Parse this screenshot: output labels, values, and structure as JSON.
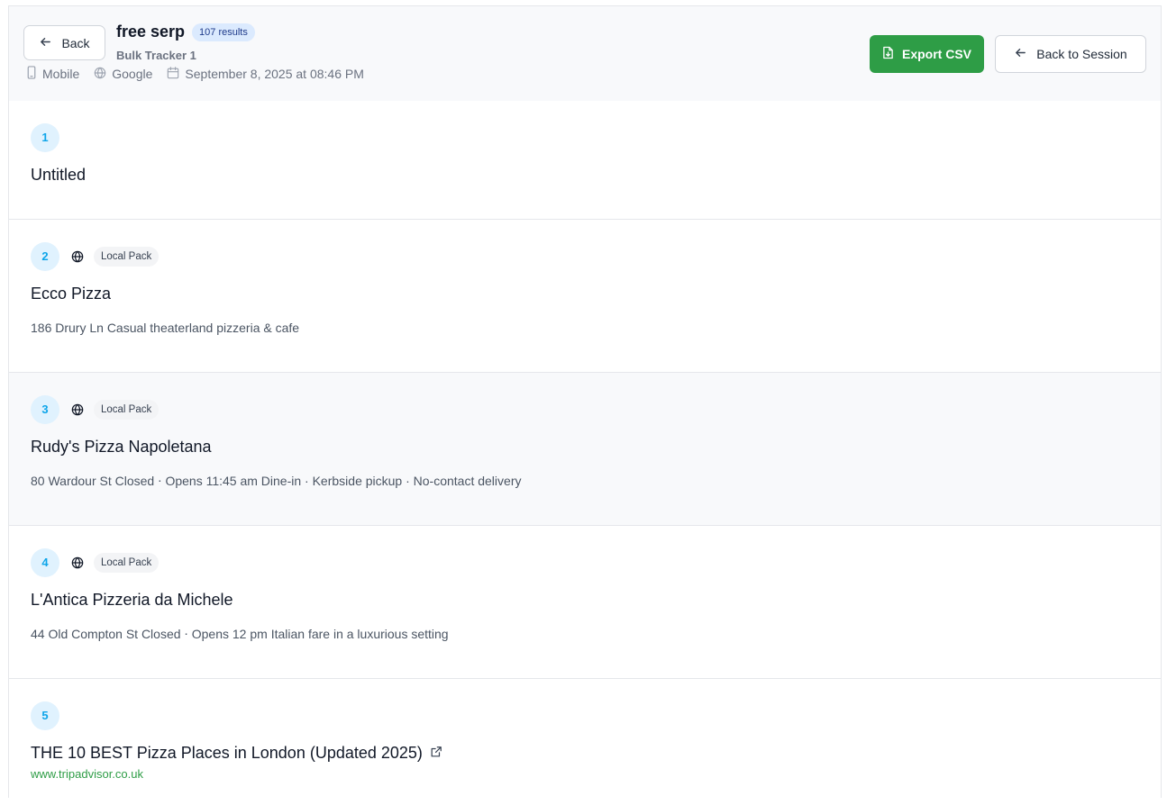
{
  "header": {
    "back_label": "Back",
    "title": "free serp",
    "results_badge": "107 results",
    "subtitle": "Bulk Tracker 1",
    "meta": {
      "device": "Mobile",
      "engine": "Google",
      "date": "September 8, 2025 at 08:46 PM"
    },
    "export_label": "Export CSV",
    "back_session_label": "Back to Session"
  },
  "colors": {
    "accent_green": "#2e9d46",
    "rank_blue": "#0ea5e9",
    "badge_blue_bg": "#dbeafe"
  },
  "results": [
    {
      "rank": "1",
      "type": "",
      "title": "Untitled",
      "desc": "",
      "url": ""
    },
    {
      "rank": "2",
      "type": "Local Pack",
      "title": "Ecco Pizza",
      "desc": "186 Drury Ln Casual theaterland pizzeria & cafe",
      "url": ""
    },
    {
      "rank": "3",
      "type": "Local Pack",
      "title": "Rudy's Pizza Napoletana",
      "desc": "80 Wardour St Closed ⋅ Opens 11:45 am Dine-in · Kerbside pickup · No-contact delivery",
      "url": ""
    },
    {
      "rank": "4",
      "type": "Local Pack",
      "title": "L'Antica Pizzeria da Michele",
      "desc": "44 Old Compton St Closed ⋅ Opens 12 pm Italian fare in a luxurious setting",
      "url": ""
    },
    {
      "rank": "5",
      "type": "",
      "title": "THE 10 BEST Pizza Places in London (Updated 2025)",
      "desc": "",
      "url": "www.tripadvisor.co.uk"
    }
  ]
}
